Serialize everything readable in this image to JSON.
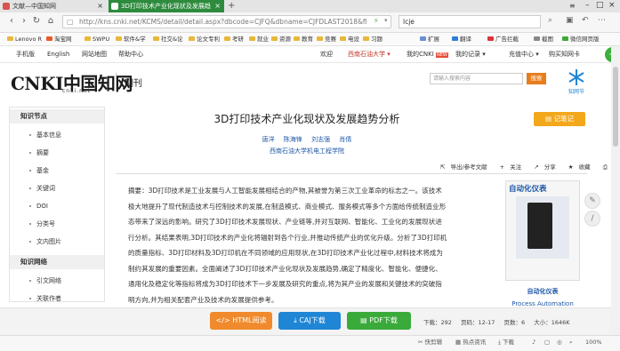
{
  "browser": {
    "tabs": [
      {
        "title": "文献—中国知网",
        "active": false
      },
      {
        "title": "3D打印技术产业化现状及发展趋",
        "active": true
      }
    ],
    "url": "http://kns.cnki.net/KCMS/detail/detail.aspx?dbcode=CJFQ&dbname=CJFDLAST2018&fi",
    "search_value": "lcje",
    "colors": {
      "active_tab": "#2e8b3e"
    }
  },
  "bookmarks": [
    "Lenovo R",
    "淘宝网",
    "SWPU",
    "软件&学",
    "社交&论",
    "论文专利",
    "考研",
    "就业",
    "资源",
    "教育",
    "竞赛",
    "电设",
    "习题",
    "扩展",
    "翻译",
    "广告拦截",
    "截图",
    "微信网页版"
  ],
  "site_nav": {
    "left": [
      "手机版",
      "English",
      "网站地图",
      "帮助中心"
    ],
    "right": [
      "欢迎",
      "西南石油大学",
      "我的CNKI",
      "我的记录",
      "充值中心",
      "购买知网卡"
    ]
  },
  "header": {
    "logo_main": "CNKI中国知网",
    "logo_sub": "cnki.net",
    "section": "期刊",
    "search_placeholder": "请输入搜索内容",
    "search_button": "搜索",
    "partner_label": "知网节"
  },
  "sidebar": {
    "sections": [
      {
        "title": "知识节点",
        "items": [
          "基本信息",
          "摘要",
          "基金",
          "关键词",
          "DOI",
          "分类号",
          "文内图片"
        ]
      },
      {
        "title": "知识网络",
        "items": [
          "引文网络",
          "关联作者"
        ]
      }
    ]
  },
  "article": {
    "title": "3D打印技术产业化现状及发展趋势分析",
    "authors": [
      "唐洋",
      "陈海锋",
      "刘志强",
      "肖倩"
    ],
    "affiliation": "西南石油大学机电工程学院",
    "note_button": "记笔记",
    "tools": [
      "导出/参考文献",
      "关注",
      "分享",
      "收藏",
      "打印"
    ],
    "abstract_label": "摘要：",
    "abstract_lines": [
      "3D打印技术是工业发展与人工智能发展相结合的产物,其被誉为第三次工业革命的标志之一。该技术",
      "极大地提升了现代制造技术与控制技术的发展,在制造模式、商业模式、服务模式等多个方面给传统制造业形",
      "态带来了深远的影响。研究了3D打印技术发展现状、产业链等,并对互联网、智能化、工业化的发展现状进",
      "行分析。其结果表明,3D打印技术的产业化将辐射到各个行业,并推动传统产业的优化升级。分析了3D打印机",
      "的质量指标、3D打印材料及3D打印机在不同领域的应用现状,在3D打印技术产业化过程中,材料技术将成为",
      "制约其发展的重要因素。全面阐述了3D打印技术产业化现状及发展趋势,确定了精度化、智能化、便捷化、",
      "通用化及稳定化等指标将成为3D打印技术下一步发展及研究的重点,将为其产业的发展和关键技术的突破指",
      "明方向,并为相关配套产业及技术的发展提供参考。"
    ]
  },
  "journal": {
    "cover_title": "自动化仪表",
    "name_cn": "自动化仪表",
    "name_en": "Process Automation"
  },
  "download": {
    "html_label": "HTML阅读",
    "caj_label": "CAJ下载",
    "pdf_label": "PDF下载",
    "downloads": "下载：292",
    "pages": "页码：12-17",
    "page_count": "页数：6",
    "size": "大小：1646K"
  },
  "statusbar": {
    "items": [
      "快剪辑",
      "热点资讯",
      "下载",
      "100%"
    ]
  }
}
